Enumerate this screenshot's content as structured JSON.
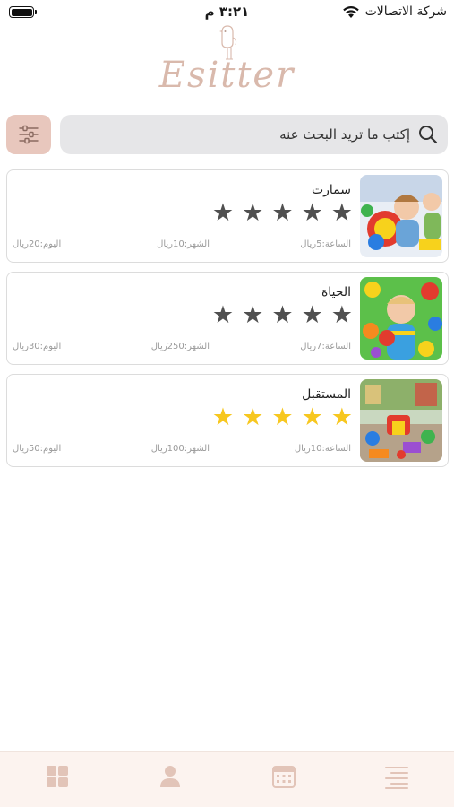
{
  "status_bar": {
    "carrier": "شركة الاتصالات",
    "time": "٣:٢١ م"
  },
  "app": {
    "logo_text": "Esitter",
    "brand_color": "#d9b9ac",
    "filter_color": "#e8c7bd"
  },
  "search": {
    "placeholder": "إكتب ما تريد البحث عنه"
  },
  "listings": [
    {
      "name": "سمارت",
      "rating_stars": 5,
      "star_color": "gray",
      "hour": "الساعة:5ريال",
      "month": "الشهر:10ريال",
      "day": "اليوم:20ريال"
    },
    {
      "name": "الحياة",
      "rating_stars": 5,
      "star_color": "gray",
      "hour": "الساعة:7ريال",
      "month": "الشهر:250ريال",
      "day": "اليوم:30ريال"
    },
    {
      "name": "المستقبل",
      "rating_stars": 5,
      "star_color": "gold",
      "hour": "الساعة:10ريال",
      "month": "الشهر:100ريال",
      "day": "اليوم:50ريال"
    }
  ],
  "tab_bar": {
    "icons": [
      "grid-icon",
      "profile-icon",
      "calendar-icon",
      "menu-icon"
    ],
    "icon_color": "#e2c4b8"
  }
}
